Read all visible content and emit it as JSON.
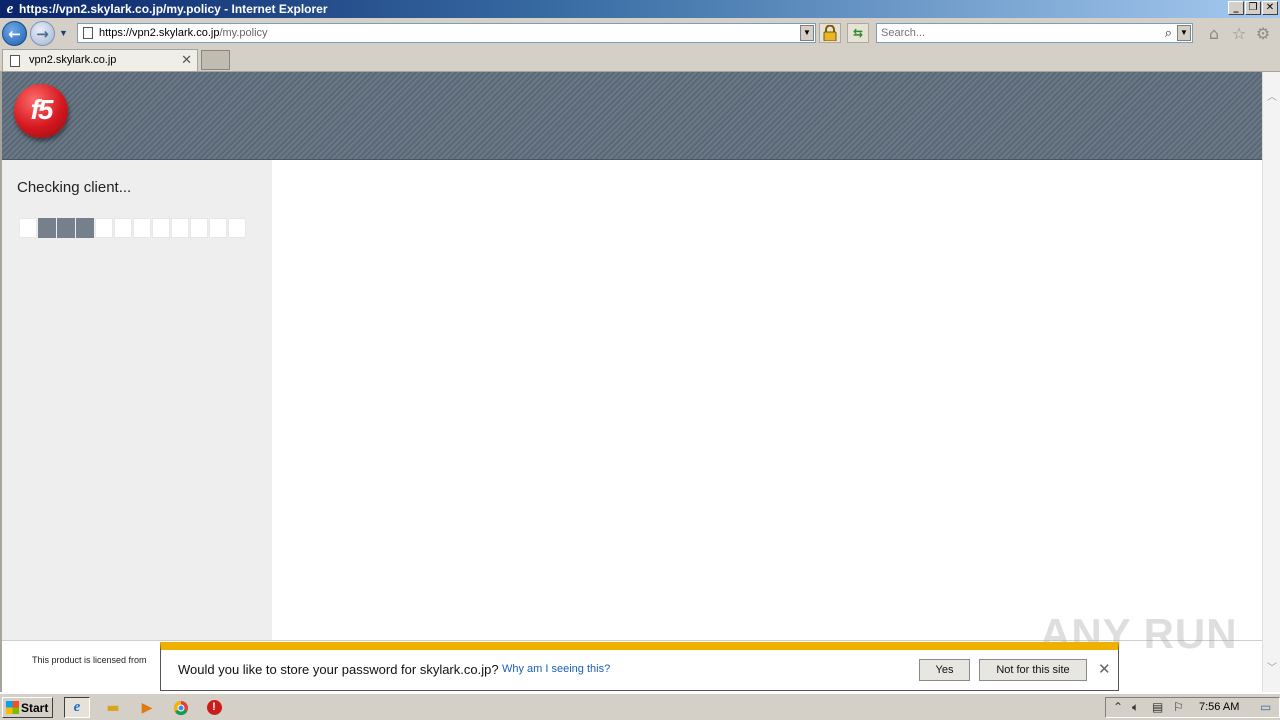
{
  "window": {
    "title": "https://vpn2.skylark.co.jp/my.policy - Internet Explorer",
    "minimize_icon": "minimize-icon",
    "restore_icon": "restore-icon",
    "close_icon": "close-icon"
  },
  "navigation": {
    "url_host": "https://vpn2.skylark.co.jp",
    "url_path": "/my.policy",
    "search_placeholder": "Search..."
  },
  "tabs": [
    {
      "label": "vpn2.skylark.co.jp",
      "active": true
    }
  ],
  "page": {
    "logo_text": "f5",
    "status_text": "Checking client...",
    "progress": {
      "total_blocks": 12,
      "active_blocks": [
        2,
        3,
        4
      ]
    },
    "footer_text": "This product is licensed from"
  },
  "password_prompt": {
    "message": "Would you like to store your password for skylark.co.jp?",
    "why_link": "Why am I seeing this?",
    "yes_label": "Yes",
    "not_for_site_label": "Not for this site"
  },
  "watermark": "ANY RUN",
  "taskbar": {
    "start_label": "Start",
    "clock": "7:56 AM"
  },
  "colors": {
    "banner": "#6b7887",
    "logo_red": "#d4181f",
    "progress_active": "#75808c",
    "notify_accent": "#f0b000"
  }
}
